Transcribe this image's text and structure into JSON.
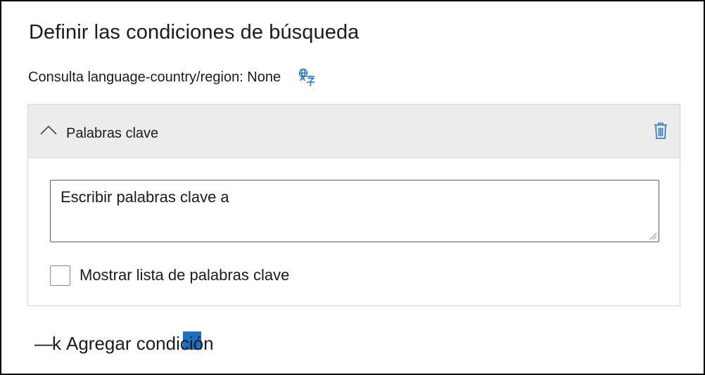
{
  "dialog": {
    "title": "Definir las condiciones de búsqueda"
  },
  "language": {
    "label": "Consulta language-country/region: None",
    "icon": "translate-icon",
    "accent": "#1f6fc5"
  },
  "condition_card": {
    "header_label": "Palabras clave",
    "chevron_icon": "chevron-up-icon",
    "delete_icon": "trash-icon",
    "keywords_field": {
      "value": "Escribir palabras clave a"
    },
    "show_list_checkbox": {
      "label": "Mostrar lista de palabras clave",
      "checked": false
    }
  },
  "add_condition": {
    "prefix": "—k",
    "label": "Agregar condición"
  }
}
